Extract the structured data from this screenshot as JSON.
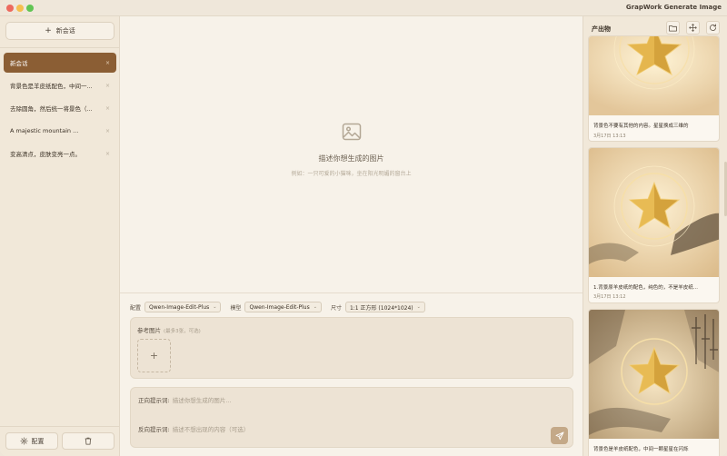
{
  "app": {
    "title": "GrapWork Generate Image"
  },
  "sidebar": {
    "new_chat_label": "新会话",
    "items": [
      {
        "label": "新会话",
        "active": true
      },
      {
        "label": "背景色是羊皮纸配色，中间一..."
      },
      {
        "label": "去除圆角，然后统一将景色（..."
      },
      {
        "label": "A majestic mountain ..."
      },
      {
        "label": "变高清点，皮肤变亮一点。"
      }
    ],
    "settings_label": "配置",
    "close_symbol": "×"
  },
  "main": {
    "empty_title": "描述你想生成的图片",
    "empty_subtitle": "例如：一只可爱的小猫咪，坐在阳光明媚的窗台上"
  },
  "controls": {
    "config_label": "配置",
    "config_value": "Qwen-Image-Edit-Plus",
    "model_label": "模型",
    "model_value": "Qwen-Image-Edit-Plus",
    "size_label": "尺寸",
    "size_value": "1:1 正方形 (1024*1024)"
  },
  "reference": {
    "title": "参考图片",
    "hint": "(最多3张，可选)",
    "add_symbol": "+"
  },
  "prompt": {
    "positive_label": "正向提示词:",
    "positive_placeholder": "描述你想生成的图片...",
    "negative_label": "反向提示词:",
    "negative_placeholder": "描述不想出现的内容（可选）"
  },
  "outputs": {
    "title": "产出物",
    "items": [
      {
        "caption": "背景色不要有其他的内容。星星换成三维的",
        "date": "3月17日 13:13"
      },
      {
        "caption": "1.背景原羊皮纸的配色，纯色的，不是羊皮纸...",
        "date": "3月17日 13:12"
      },
      {
        "caption": "背景色是羊皮纸配色，中间一颗星星在闪烁"
      }
    ]
  },
  "colors": {
    "accent": "#8b5e34",
    "background": "#f7f2e9",
    "sidebar": "#f1e8d9",
    "send_button": "#c4a988"
  }
}
